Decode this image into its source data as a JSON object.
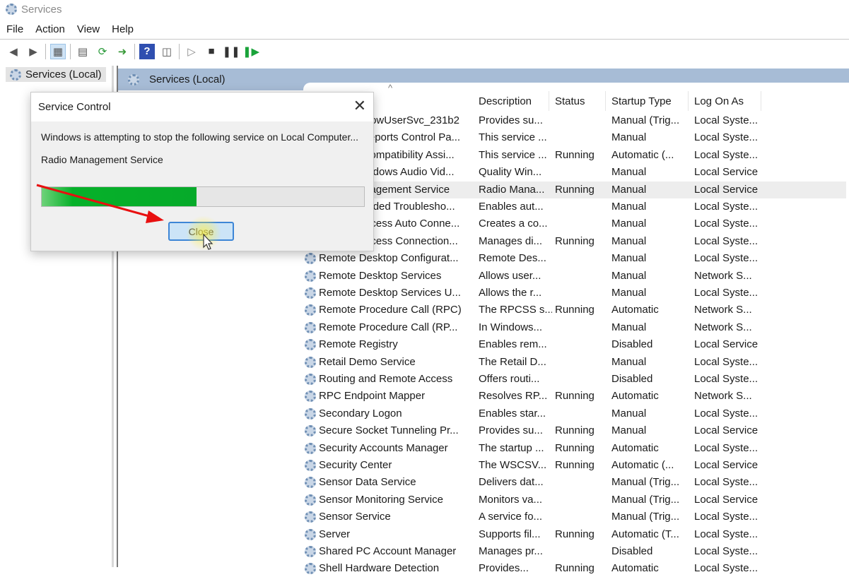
{
  "window": {
    "title": "Services",
    "icon": "gear-icon"
  },
  "menu": [
    "File",
    "Action",
    "View",
    "Help"
  ],
  "toolbar": {
    "icons": [
      "back-arrow-icon",
      "forward-arrow-icon",
      "console-tree-icon",
      "properties-icon",
      "refresh-icon",
      "export-list-icon",
      "help-icon",
      "details-pane-icon",
      "start-service-icon",
      "stop-service-icon",
      "pause-service-icon",
      "resume-service-icon"
    ]
  },
  "left_pane": {
    "item": "Services (Local)"
  },
  "right_pane": {
    "header": "Services (Local)"
  },
  "columns": [
    "Description",
    "Status",
    "Startup Type",
    "Log On As"
  ],
  "rows": [
    [
      "PrintWorkflowUserSvc_231b2",
      "Provides su...",
      "",
      "Manual (Trig...",
      "Local Syste..."
    ],
    [
      "Problem Reports Control Pa...",
      "This service ...",
      "",
      "Manual",
      "Local Syste..."
    ],
    [
      "Program Compatibility Assi...",
      "This service ...",
      "Running",
      "Automatic (...",
      "Local Syste..."
    ],
    [
      "Quality Windows Audio Vid...",
      "Quality Win...",
      "",
      "Manual",
      "Local Service"
    ],
    [
      "Radio Management Service",
      "Radio Mana...",
      "Running",
      "Manual",
      "Local Service"
    ],
    [
      "Recommended Troublesho...",
      "Enables aut...",
      "",
      "Manual",
      "Local Syste..."
    ],
    [
      "Remote Access Auto Conne...",
      "Creates a co...",
      "",
      "Manual",
      "Local Syste..."
    ],
    [
      "Remote Access Connection...",
      "Manages di...",
      "Running",
      "Manual",
      "Local Syste..."
    ],
    [
      "Remote Desktop Configurat...",
      "Remote Des...",
      "",
      "Manual",
      "Local Syste..."
    ],
    [
      "Remote Desktop Services",
      "Allows user...",
      "",
      "Manual",
      "Network S..."
    ],
    [
      "Remote Desktop Services U...",
      "Allows the r...",
      "",
      "Manual",
      "Local Syste..."
    ],
    [
      "Remote Procedure Call (RPC)",
      "The RPCSS s...",
      "Running",
      "Automatic",
      "Network S..."
    ],
    [
      "Remote Procedure Call (RP...",
      "In Windows...",
      "",
      "Manual",
      "Network S..."
    ],
    [
      "Remote Registry",
      "Enables rem...",
      "",
      "Disabled",
      "Local Service"
    ],
    [
      "Retail Demo Service",
      "The Retail D...",
      "",
      "Manual",
      "Local Syste..."
    ],
    [
      "Routing and Remote Access",
      "Offers routi...",
      "",
      "Disabled",
      "Local Syste..."
    ],
    [
      "RPC Endpoint Mapper",
      "Resolves RP...",
      "Running",
      "Automatic",
      "Network S..."
    ],
    [
      "Secondary Logon",
      "Enables star...",
      "",
      "Manual",
      "Local Syste..."
    ],
    [
      "Secure Socket Tunneling Pr...",
      "Provides su...",
      "Running",
      "Manual",
      "Local Service"
    ],
    [
      "Security Accounts Manager",
      "The startup ...",
      "Running",
      "Automatic",
      "Local Syste..."
    ],
    [
      "Security Center",
      "The WSCSV...",
      "Running",
      "Automatic (...",
      "Local Service"
    ],
    [
      "Sensor Data Service",
      "Delivers dat...",
      "",
      "Manual (Trig...",
      "Local Syste..."
    ],
    [
      "Sensor Monitoring Service",
      "Monitors va...",
      "",
      "Manual (Trig...",
      "Local Service"
    ],
    [
      "Sensor Service",
      "A service fo...",
      "",
      "Manual (Trig...",
      "Local Syste..."
    ],
    [
      "Server",
      "Supports fil...",
      "Running",
      "Automatic (T...",
      "Local Syste..."
    ],
    [
      "Shared PC Account Manager",
      "Manages pr...",
      "",
      "Disabled",
      "Local Syste..."
    ],
    [
      "Shell Hardware Detection",
      "Provides...",
      "Running",
      "Automatic",
      "Local Syste..."
    ]
  ],
  "selected_row": 4,
  "dialog": {
    "title": "Service Control",
    "message": "Windows is attempting to stop the following service on Local Computer...",
    "service": "Radio Management Service",
    "progress_percent": 48,
    "close_button": "Close",
    "progress_color": "#06b12a"
  }
}
